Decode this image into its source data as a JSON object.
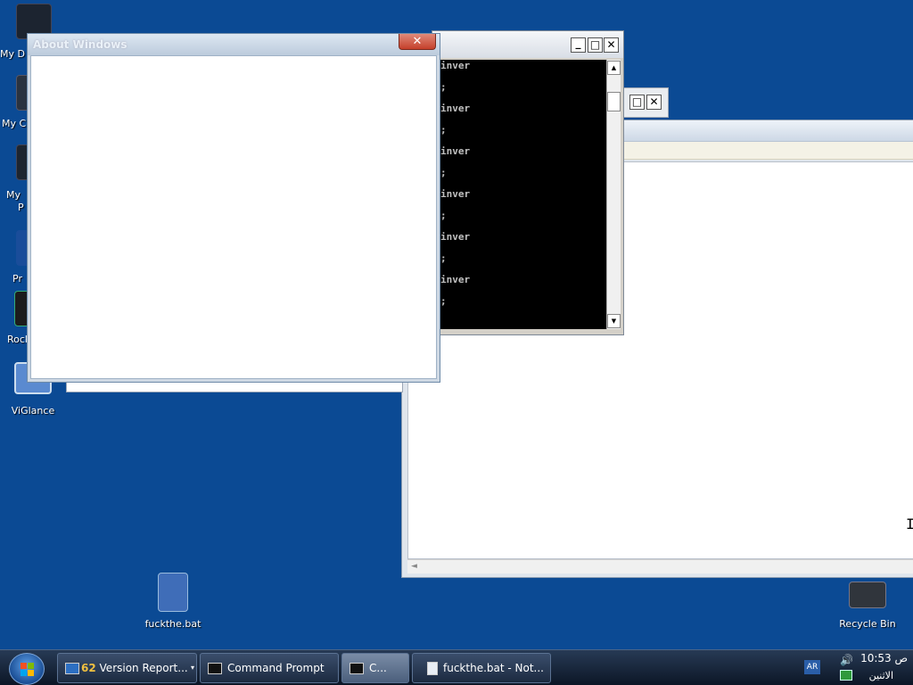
{
  "desktop": {
    "icons": [
      {
        "label": "My D",
        "icon": "documents-folder-icon",
        "color": "#1c2430"
      },
      {
        "label": "My C",
        "icon": "computer-icon",
        "color": "#2a3340"
      },
      {
        "label": "My",
        "label2": "P",
        "icon": "network-places-icon",
        "color": "#1d2530"
      },
      {
        "label": "Pr",
        "icon": "printer-icon",
        "color": "#1a4d9a"
      },
      {
        "label": "Rock",
        "icon": "rock-app-icon",
        "color": "#1c1c1c"
      },
      {
        "label": "ViGlance",
        "icon": "viglance-icon",
        "color": "#5a8ad0"
      },
      {
        "label": "fuckthe.bat",
        "icon": "gear-batch-icon",
        "color": "#3f6db8"
      },
      {
        "label": "Recycle Bin",
        "icon": "recycle-bin-icon",
        "color": "#30353c"
      }
    ]
  },
  "about_window": {
    "title": "About Windows",
    "close_glyph": "✕"
  },
  "cmd_window": {
    "lines": [
      "inver",
      ";",
      "inver",
      ";",
      "inver",
      ";",
      "inver",
      ";",
      "inver",
      ";",
      "inver",
      ";"
    ],
    "min_glyph": "_",
    "max_glyph": "□",
    "close_glyph": "✕",
    "up_glyph": "▲",
    "down_glyph": "▼"
  },
  "small_window": {
    "max_glyph": "□",
    "close_glyph": "✕"
  },
  "notepad": {
    "scroll_left_glyph": "◄",
    "cursor_glyph": "I"
  },
  "taskbar": {
    "buttons": [
      {
        "count": "62",
        "label": "Version Report...",
        "icon": "report-icon",
        "has_dropdown": true,
        "dropdown_glyph": "▾"
      },
      {
        "label": "Command Prompt",
        "icon": "cmd-icon"
      },
      {
        "label": "C...",
        "icon": "cmd-icon",
        "active": true
      },
      {
        "label": "fuckthe.bat - Not...",
        "icon": "notepad-icon"
      }
    ],
    "tray": {
      "language": "AR",
      "volume_glyph": "🔊",
      "time": "10:53 ص",
      "day": "الاثنين"
    }
  },
  "colors": {
    "desktop": "#0b4a94",
    "cmd_background": "#000000",
    "cmd_text": "#c0c0c0",
    "close_button": "#c5402b"
  }
}
